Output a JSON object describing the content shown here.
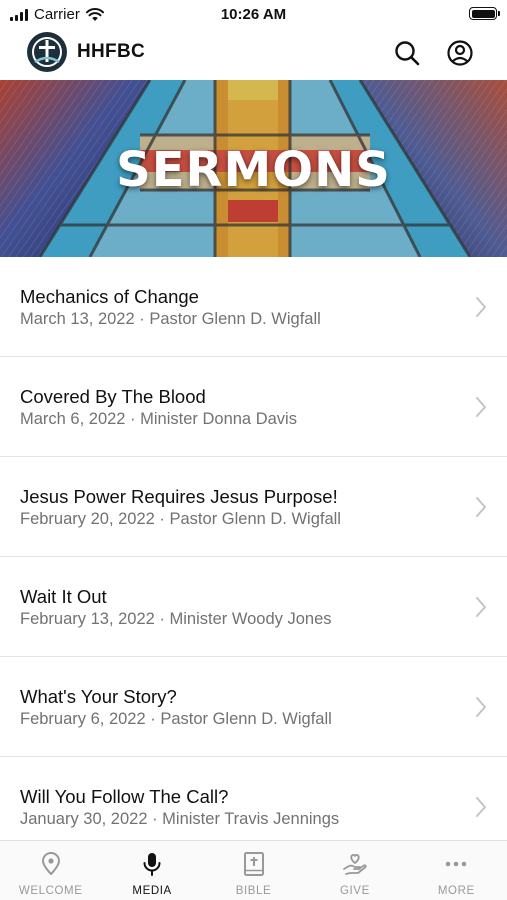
{
  "status_bar": {
    "carrier": "Carrier",
    "time": "10:26 AM"
  },
  "header": {
    "title": "HHFBC",
    "logo_icon": "church-logo-icon",
    "search_icon": "search-icon",
    "account_icon": "account-icon"
  },
  "banner": {
    "title": "SERMONS"
  },
  "sermons": [
    {
      "title": "Mechanics of Change",
      "meta": "March 13, 2022 · Pastor Glenn D. Wigfall"
    },
    {
      "title": "Covered By The Blood",
      "meta": "March 6, 2022 · Minister Donna Davis"
    },
    {
      "title": "Jesus Power Requires Jesus Purpose!",
      "meta": "February 20, 2022 · Pastor Glenn D. Wigfall"
    },
    {
      "title": "Wait It Out",
      "meta": "February 13, 2022 · Minister Woody Jones"
    },
    {
      "title": "What's Your Story?",
      "meta": "February 6, 2022 · Pastor Glenn D. Wigfall"
    },
    {
      "title": "Will You Follow The Call?",
      "meta": "January 30, 2022 · Minister Travis Jennings"
    }
  ],
  "tabs": [
    {
      "label": "WELCOME",
      "icon": "location-pin-icon",
      "active": false
    },
    {
      "label": "MEDIA",
      "icon": "microphone-icon",
      "active": true
    },
    {
      "label": "BIBLE",
      "icon": "bible-icon",
      "active": false
    },
    {
      "label": "GIVE",
      "icon": "hand-heart-icon",
      "active": false
    },
    {
      "label": "MORE",
      "icon": "more-dots-icon",
      "active": false
    }
  ],
  "colors": {
    "active_tab": "#111111",
    "inactive_tab": "#999999",
    "meta_text": "#727272",
    "logo_bg": "#1c2f3a"
  }
}
